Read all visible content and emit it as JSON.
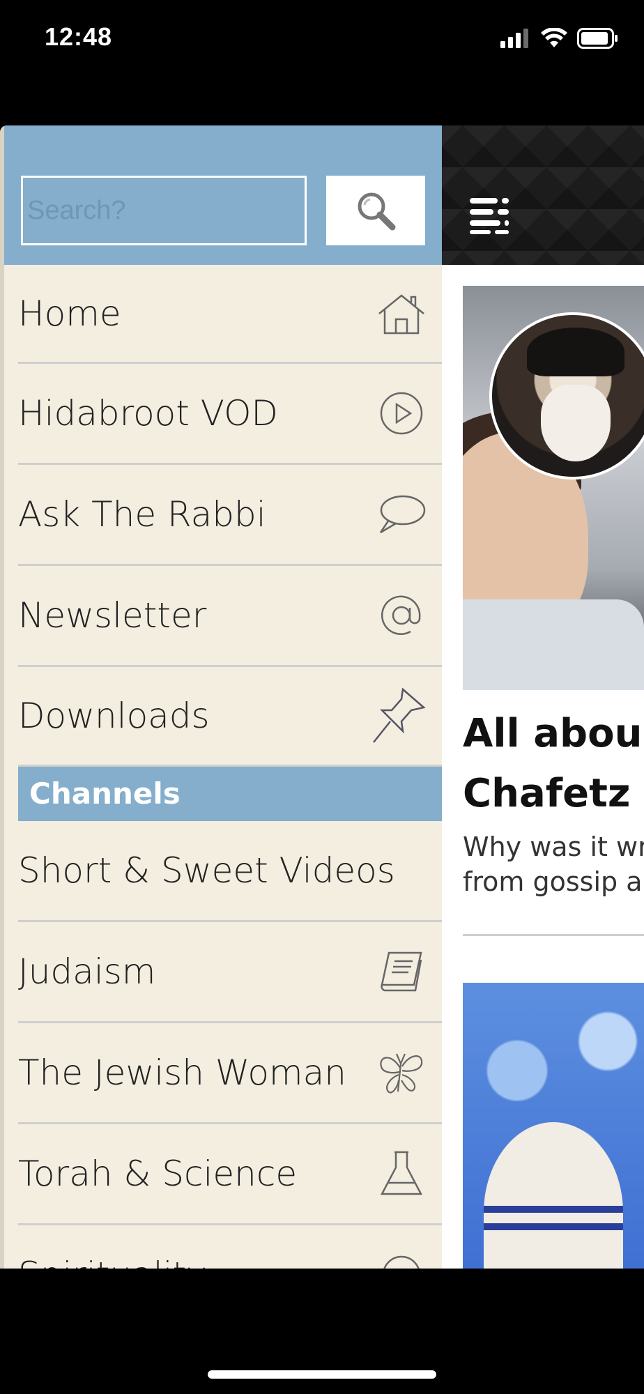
{
  "status_bar": {
    "time": "12:48",
    "icons": [
      "signal-icon",
      "wifi-icon",
      "battery-icon"
    ]
  },
  "search": {
    "placeholder": "Search?",
    "button_icon": "search-icon"
  },
  "menu": {
    "items": [
      {
        "label": "Home",
        "icon": "home-icon"
      },
      {
        "label": "Hidabroot VOD",
        "icon": "play-circle-icon"
      },
      {
        "label": "Ask The Rabbi",
        "icon": "speech-bubble-icon"
      },
      {
        "label": "Newsletter",
        "icon": "at-sign-icon"
      },
      {
        "label": "Downloads",
        "icon": "pushpin-icon"
      }
    ],
    "channels_header": "Channels",
    "channels": [
      {
        "label": "Short & Sweet Videos",
        "icon": ""
      },
      {
        "label": "Judaism",
        "icon": "book-icon"
      },
      {
        "label": "The Jewish Woman",
        "icon": "butterfly-icon"
      },
      {
        "label": "Torah & Science",
        "icon": "flask-icon"
      },
      {
        "label": "Spirituality",
        "icon": "circle-icon"
      }
    ]
  },
  "content": {
    "menu_toggle_icon": "list-menu-icon",
    "article": {
      "title": "All abou\nChafetz",
      "summary": "Why was it wr\nfrom gossip a"
    }
  },
  "colors": {
    "accent": "#84aecb",
    "drawer_bg": "#f3eee0",
    "divider": "#cfcfcf"
  }
}
